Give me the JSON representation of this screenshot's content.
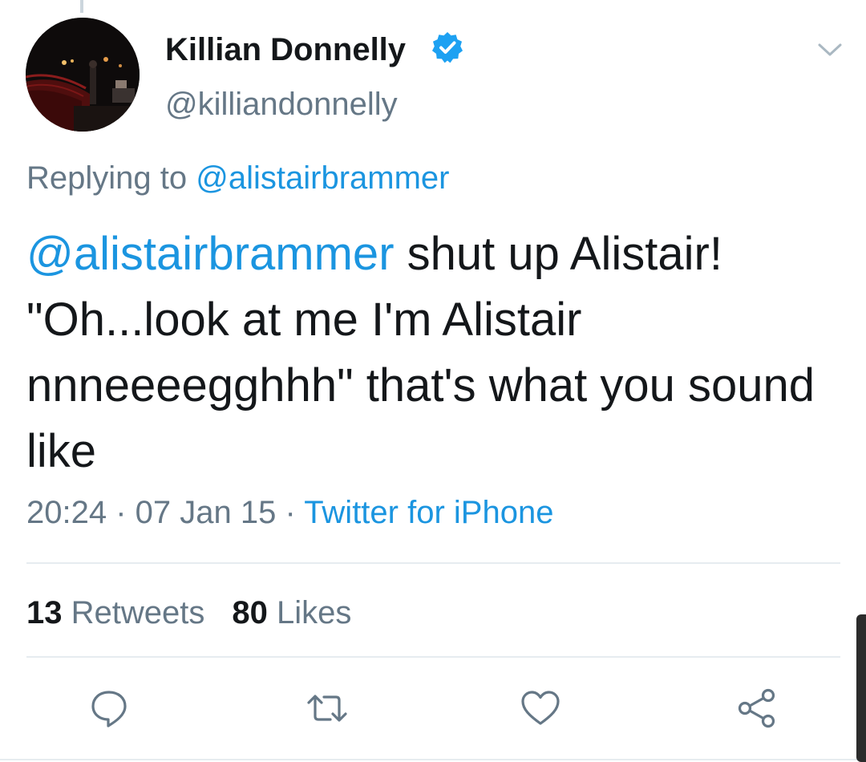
{
  "tweet": {
    "author": {
      "display_name": "Killian Donnelly",
      "handle": "@killiandonnelly",
      "verified": true
    },
    "replying_to": {
      "prefix": "Replying to",
      "mention": "@alistairbrammer"
    },
    "text": {
      "mention": "@alistairbrammer",
      "body_line1": " shut up Alistair!",
      "body_rest": "\"Oh...look at me I'm Alistair nnneeeegghhh\" that's what you sound like"
    },
    "meta": {
      "time": "20:24",
      "separator": " · ",
      "date": "07 Jan 15",
      "source": "Twitter for iPhone"
    },
    "stats": {
      "retweets_count": "13",
      "retweets_label": " Retweets",
      "likes_count": "80",
      "likes_label": " Likes"
    },
    "actions": [
      "reply-icon",
      "retweet-icon",
      "like-icon",
      "share-icon"
    ]
  },
  "colors": {
    "link": "#1b95e0",
    "secondary_text": "#657786",
    "primary_text": "#14171a",
    "divider": "#e6ecf0",
    "verified_badge": "#1da1f2"
  }
}
